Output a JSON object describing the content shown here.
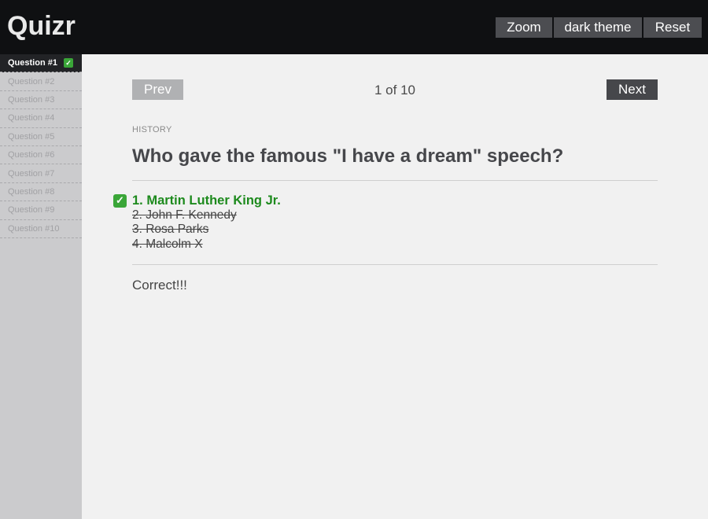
{
  "app": {
    "title": "Quizr"
  },
  "toolbar": {
    "zoom_label": "Zoom",
    "theme_label": "dark theme",
    "reset_label": "Reset"
  },
  "sidebar": {
    "items": [
      {
        "label": "Question #1",
        "active": true,
        "answered": true
      },
      {
        "label": "Question #2"
      },
      {
        "label": "Question #3"
      },
      {
        "label": "Question #4"
      },
      {
        "label": "Question #5"
      },
      {
        "label": "Question #6"
      },
      {
        "label": "Question #7"
      },
      {
        "label": "Question #8"
      },
      {
        "label": "Question #9"
      },
      {
        "label": "Question #10"
      }
    ],
    "check_icon": "check-mark-icon",
    "check_glyph": "✓"
  },
  "nav": {
    "prev_label": "Prev",
    "next_label": "Next",
    "counter": "1 of 10"
  },
  "question": {
    "category": "HISTORY",
    "text": "Who gave the famous \"I have a dream\" speech?",
    "answers": [
      {
        "label": "1. Martin Luther King Jr.",
        "state": "correct"
      },
      {
        "label": "2. John F. Kennedy",
        "state": "wrong"
      },
      {
        "label": "3. Rosa Parks",
        "state": "wrong"
      },
      {
        "label": "4. Malcolm X",
        "state": "wrong"
      }
    ],
    "feedback": "Correct!!!"
  },
  "colors": {
    "accent_green": "#1d8a1d",
    "check_green": "#3aa638",
    "topbar": "#0f1012"
  }
}
